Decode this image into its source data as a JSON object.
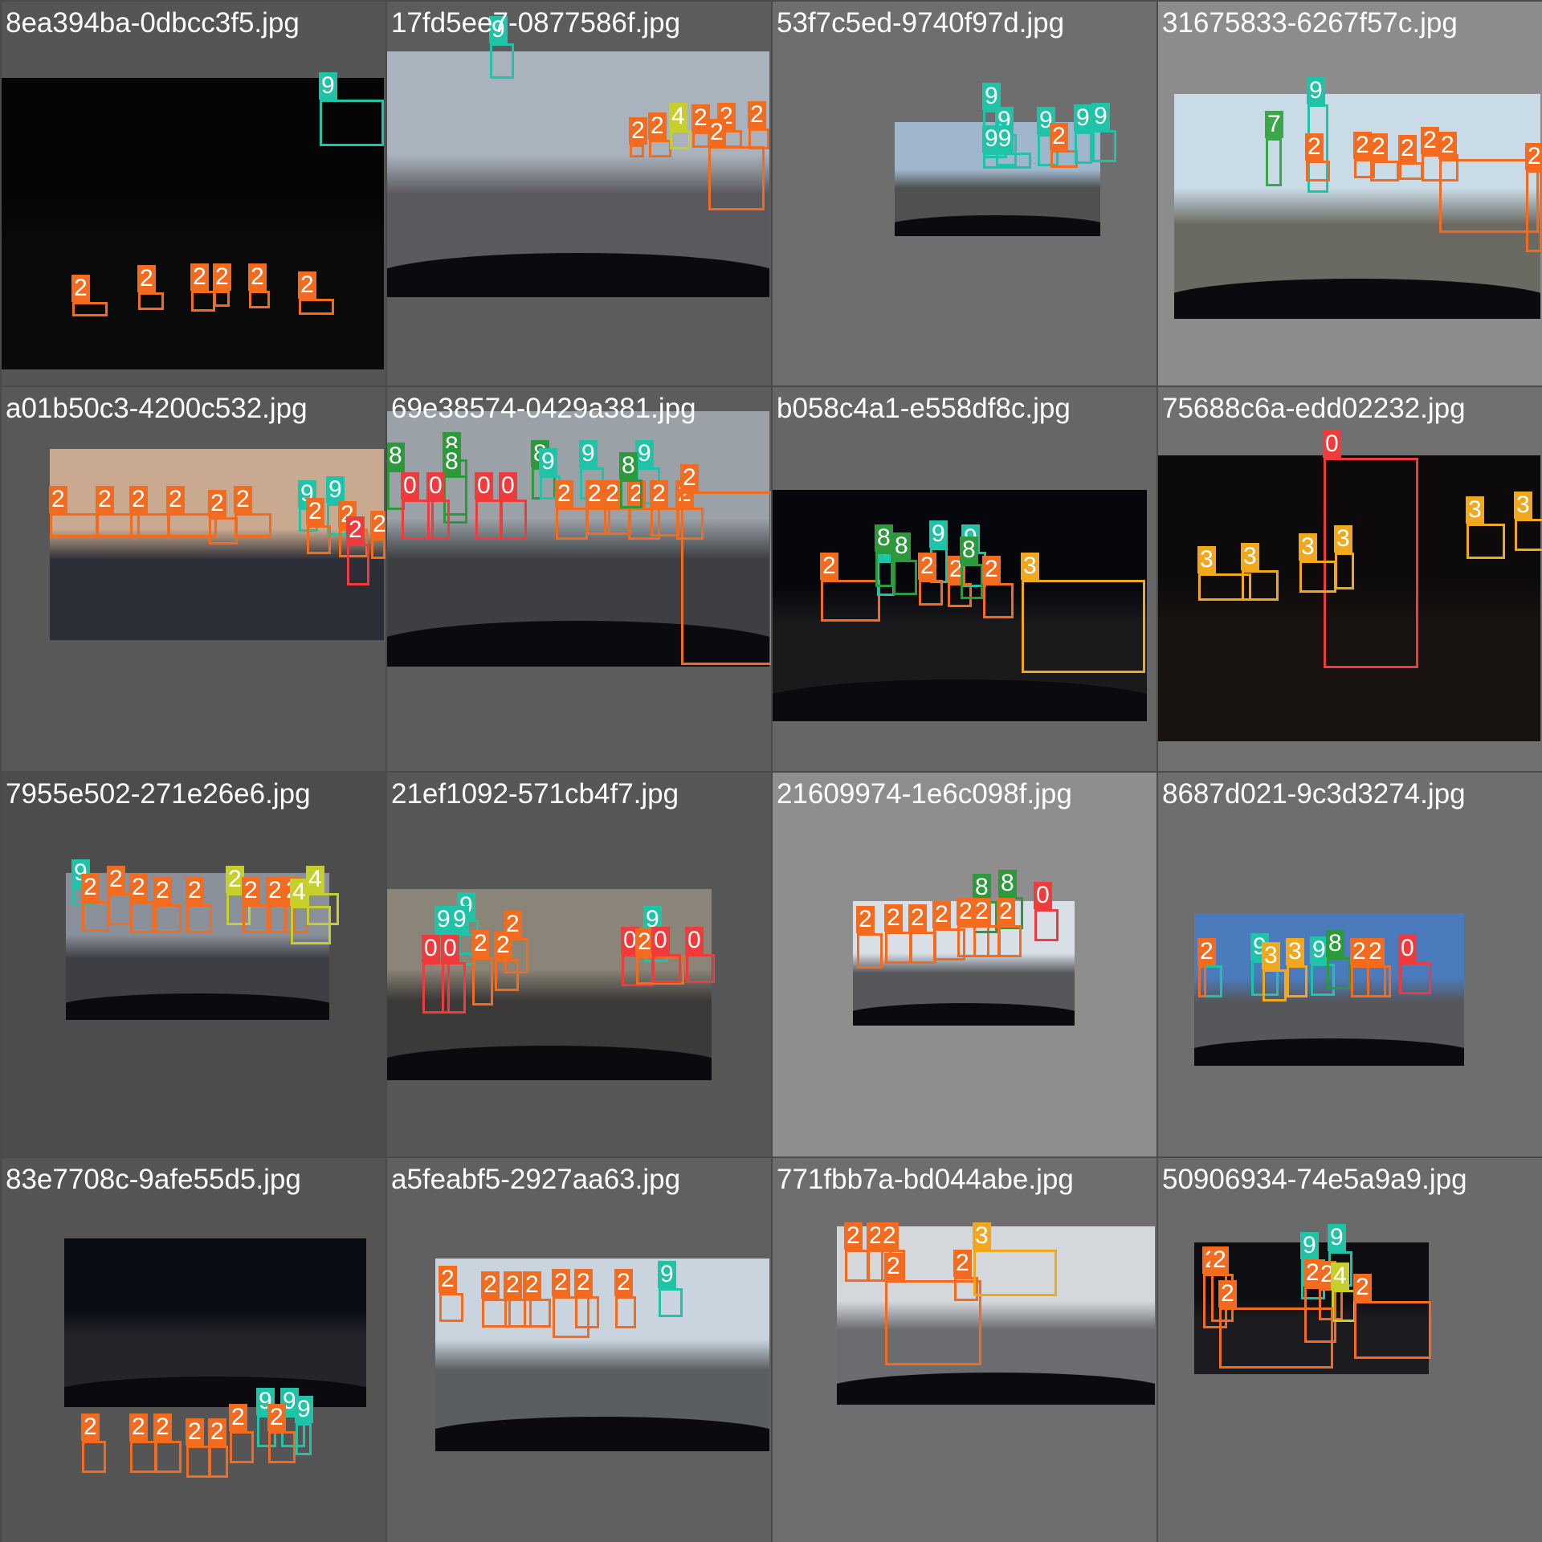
{
  "class_colors": {
    "0": "#ef3b3b",
    "2": "#f26b1f",
    "3": "#f2a81d",
    "4": "#c6cf2b",
    "7": "#3ca64a",
    "8": "#2c9a3a",
    "9": "#1fc4a8"
  },
  "tiles": [
    {
      "title": "8ea394ba-0dbcc3f5.jpg",
      "bg": "#555555",
      "photo": {
        "sky": "#050505",
        "ground": "#0a0a0a",
        "hood": false
      },
      "detections": [
        {
          "cls": "9",
          "label": "9"
        },
        {
          "cls": "2",
          "label": "2"
        },
        {
          "cls": "2",
          "label": "2"
        },
        {
          "cls": "2",
          "label": "2"
        },
        {
          "cls": "2",
          "label": "2"
        },
        {
          "cls": "2",
          "label": "2"
        },
        {
          "cls": "2",
          "label": "2"
        }
      ]
    },
    {
      "title": "17fd5ee7-0877586f.jpg",
      "bg": "#5c5c5c",
      "photo": {
        "sky": "#a9b3bd",
        "ground": "#5a5a5e",
        "hood": true
      },
      "detections": [
        {
          "cls": "9",
          "label": "9"
        },
        {
          "cls": "2",
          "label": "2"
        },
        {
          "cls": "2",
          "label": "2"
        },
        {
          "cls": "4",
          "label": "4"
        },
        {
          "cls": "2",
          "label": "2"
        },
        {
          "cls": "2",
          "label": "2"
        },
        {
          "cls": "2",
          "label": "2"
        },
        {
          "cls": "2",
          "label": "2"
        }
      ]
    },
    {
      "title": "53f7c5ed-9740f97d.jpg",
      "bg": "#6e6e6e",
      "photo": {
        "sky": "#9fb6cc",
        "ground": "#4e5150",
        "hood": true
      },
      "detections": [
        {
          "cls": "9",
          "label": "9"
        },
        {
          "cls": "9",
          "label": "9"
        },
        {
          "cls": "9",
          "label": "99"
        },
        {
          "cls": "9",
          "label": "9"
        },
        {
          "cls": "2",
          "label": "2"
        },
        {
          "cls": "9",
          "label": "9"
        },
        {
          "cls": "9",
          "label": "9"
        }
      ]
    },
    {
      "title": "31675833-6267f57c.jpg",
      "bg": "#8c8c8c",
      "photo": {
        "sky": "#c8dbe6",
        "ground": "#6b6a62",
        "hood": true
      },
      "detections": [
        {
          "cls": "9",
          "label": "9"
        },
        {
          "cls": "7",
          "label": "7"
        },
        {
          "cls": "2",
          "label": "2"
        },
        {
          "cls": "2",
          "label": "2"
        },
        {
          "cls": "2",
          "label": "2"
        },
        {
          "cls": "2",
          "label": "2"
        },
        {
          "cls": "2",
          "label": "2"
        },
        {
          "cls": "2",
          "label": "2"
        },
        {
          "cls": "2",
          "label": "2"
        }
      ]
    },
    {
      "title": "a01b50c3-4200c532.jpg",
      "bg": "#585858",
      "photo": {
        "sky": "#c9a98f",
        "ground": "#2b2e36",
        "hood": false
      },
      "detections": [
        {
          "cls": "2",
          "label": "2"
        },
        {
          "cls": "2",
          "label": "2"
        },
        {
          "cls": "2",
          "label": "2"
        },
        {
          "cls": "2",
          "label": "2"
        },
        {
          "cls": "2",
          "label": "2"
        },
        {
          "cls": "2",
          "label": "2"
        },
        {
          "cls": "9",
          "label": "9"
        },
        {
          "cls": "9",
          "label": "9"
        },
        {
          "cls": "2",
          "label": "2"
        },
        {
          "cls": "2",
          "label": "2"
        },
        {
          "cls": "0",
          "label": "2"
        },
        {
          "cls": "2",
          "label": "2"
        }
      ]
    },
    {
      "title": "69e38574-0429a381.jpg",
      "bg": "#5c5c5c",
      "photo": {
        "sky": "#9aa2a8",
        "ground": "#3d3f42",
        "hood": true
      },
      "detections": [
        {
          "cls": "8",
          "label": "8"
        },
        {
          "cls": "8",
          "label": "8"
        },
        {
          "cls": "8",
          "label": "8"
        },
        {
          "cls": "8",
          "label": "8"
        },
        {
          "cls": "9",
          "label": "9"
        },
        {
          "cls": "9",
          "label": "9"
        },
        {
          "cls": "9",
          "label": "9"
        },
        {
          "cls": "0",
          "label": "0"
        },
        {
          "cls": "0",
          "label": "0"
        },
        {
          "cls": "0",
          "label": "0"
        },
        {
          "cls": "0",
          "label": "0"
        },
        {
          "cls": "2",
          "label": "2"
        },
        {
          "cls": "2",
          "label": "2"
        },
        {
          "cls": "2",
          "label": "2"
        },
        {
          "cls": "2",
          "label": "2"
        },
        {
          "cls": "2",
          "label": "2"
        },
        {
          "cls": "2",
          "label": "2"
        },
        {
          "cls": "8",
          "label": "8"
        },
        {
          "cls": "2",
          "label": "2"
        }
      ]
    },
    {
      "title": "b058c4a1-e558df8c.jpg",
      "bg": "#666666",
      "photo": {
        "sky": "#06070c",
        "ground": "#1a1a1c",
        "hood": true
      },
      "detections": [
        {
          "cls": "2",
          "label": "2"
        },
        {
          "cls": "9",
          "label": "9"
        },
        {
          "cls": "8",
          "label": "8"
        },
        {
          "cls": "8",
          "label": "8"
        },
        {
          "cls": "9",
          "label": "9"
        },
        {
          "cls": "9",
          "label": "9"
        },
        {
          "cls": "2",
          "label": "2"
        },
        {
          "cls": "2",
          "label": "2"
        },
        {
          "cls": "8",
          "label": "8"
        },
        {
          "cls": "2",
          "label": "2"
        },
        {
          "cls": "3",
          "label": "3"
        }
      ]
    },
    {
      "title": "75688c6a-edd02232.jpg",
      "bg": "#707070",
      "photo": {
        "sky": "#0c0a0a",
        "ground": "#181210",
        "hood": false
      },
      "detections": [
        {
          "cls": "0",
          "label": "0"
        },
        {
          "cls": "3",
          "label": "3"
        },
        {
          "cls": "3",
          "label": "3"
        },
        {
          "cls": "3",
          "label": "3"
        },
        {
          "cls": "3",
          "label": "3"
        },
        {
          "cls": "3",
          "label": "3"
        },
        {
          "cls": "3",
          "label": "3"
        },
        {
          "cls": "3",
          "label": "3"
        },
        {
          "cls": "3",
          "label": "3"
        }
      ]
    },
    {
      "title": "7955e502-271e26e6.jpg",
      "bg": "#4c4c4c",
      "photo": {
        "sky": "#8a9099",
        "ground": "#3d3f44",
        "hood": true
      },
      "detections": [
        {
          "cls": "9",
          "label": "9"
        },
        {
          "cls": "2",
          "label": "2"
        },
        {
          "cls": "2",
          "label": "2"
        },
        {
          "cls": "2",
          "label": "2"
        },
        {
          "cls": "2",
          "label": "2"
        },
        {
          "cls": "2",
          "label": "2"
        },
        {
          "cls": "4",
          "label": "2"
        },
        {
          "cls": "2",
          "label": "2"
        },
        {
          "cls": "2",
          "label": "2"
        },
        {
          "cls": "2",
          "label": "2"
        },
        {
          "cls": "4",
          "label": "4"
        },
        {
          "cls": "4",
          "label": "4"
        }
      ]
    },
    {
      "title": "21ef1092-571cb4f7.jpg",
      "bg": "#575757",
      "photo": {
        "sky": "#8b8478",
        "ground": "#3b3a38",
        "hood": true
      },
      "detections": [
        {
          "cls": "9",
          "label": "9"
        },
        {
          "cls": "9",
          "label": "9"
        },
        {
          "cls": "9",
          "label": "9"
        },
        {
          "cls": "2",
          "label": "2"
        },
        {
          "cls": "0",
          "label": "0"
        },
        {
          "cls": "0",
          "label": "0"
        },
        {
          "cls": "2",
          "label": "2"
        },
        {
          "cls": "2",
          "label": "2"
        },
        {
          "cls": "9",
          "label": "9"
        },
        {
          "cls": "0",
          "label": "0"
        },
        {
          "cls": "2",
          "label": "2"
        },
        {
          "cls": "0",
          "label": "0"
        },
        {
          "cls": "0",
          "label": "0"
        }
      ]
    },
    {
      "title": "21609974-1e6c098f.jpg",
      "bg": "#8e8e8e",
      "photo": {
        "sky": "#d8dfe6",
        "ground": "#55575b",
        "hood": true
      },
      "detections": [
        {
          "cls": "2",
          "label": "2"
        },
        {
          "cls": "2",
          "label": "2"
        },
        {
          "cls": "2",
          "label": "2"
        },
        {
          "cls": "2",
          "label": "2"
        },
        {
          "cls": "2",
          "label": "2"
        },
        {
          "cls": "8",
          "label": "8"
        },
        {
          "cls": "8",
          "label": "8"
        },
        {
          "cls": "2",
          "label": "2"
        },
        {
          "cls": "2",
          "label": "2"
        },
        {
          "cls": "0",
          "label": "0"
        }
      ]
    },
    {
      "title": "8687d021-9c3d3274.jpg",
      "bg": "#6e6e6e",
      "photo": {
        "sky": "#4b7bbd",
        "ground": "#55575a",
        "hood": true
      },
      "detections": [
        {
          "cls": "9",
          "label": "9"
        },
        {
          "cls": "2",
          "label": "2"
        },
        {
          "cls": "9",
          "label": "9"
        },
        {
          "cls": "3",
          "label": "3"
        },
        {
          "cls": "3",
          "label": "3"
        },
        {
          "cls": "9",
          "label": "9"
        },
        {
          "cls": "8",
          "label": "8"
        },
        {
          "cls": "2",
          "label": "2"
        },
        {
          "cls": "2",
          "label": "2"
        },
        {
          "cls": "0",
          "label": "0"
        }
      ]
    },
    {
      "title": "83e7708c-9afe55d5.jpg",
      "bg": "#555555",
      "photo": {
        "sky": "#0a0c14",
        "ground": "#24252a",
        "hood": true
      },
      "detections": [
        {
          "cls": "2",
          "label": "2"
        },
        {
          "cls": "2",
          "label": "2"
        },
        {
          "cls": "2",
          "label": "2"
        },
        {
          "cls": "2",
          "label": "2"
        },
        {
          "cls": "2",
          "label": "2"
        },
        {
          "cls": "2",
          "label": "2"
        },
        {
          "cls": "9",
          "label": "9"
        },
        {
          "cls": "9",
          "label": "9"
        },
        {
          "cls": "2",
          "label": "2"
        },
        {
          "cls": "9",
          "label": "9"
        }
      ]
    },
    {
      "title": "a5feabf5-2927aa63.jpg",
      "bg": "#606060",
      "photo": {
        "sky": "#c9d4de",
        "ground": "#5b5e60",
        "hood": true
      },
      "detections": [
        {
          "cls": "2",
          "label": "2"
        },
        {
          "cls": "2",
          "label": "2"
        },
        {
          "cls": "2",
          "label": "2"
        },
        {
          "cls": "2",
          "label": "2"
        },
        {
          "cls": "2",
          "label": "2"
        },
        {
          "cls": "2",
          "label": "2"
        },
        {
          "cls": "2",
          "label": "2"
        },
        {
          "cls": "9",
          "label": "9"
        }
      ]
    },
    {
      "title": "771fbb7a-bd044abe.jpg",
      "bg": "#6e6e6e",
      "photo": {
        "sky": "#d4d8dc",
        "ground": "#6a6c70",
        "hood": true
      },
      "detections": [
        {
          "cls": "2",
          "label": "2"
        },
        {
          "cls": "2",
          "label": "2"
        },
        {
          "cls": "2",
          "label": "2"
        },
        {
          "cls": "2",
          "label": "2"
        },
        {
          "cls": "2",
          "label": "2"
        },
        {
          "cls": "3",
          "label": "3"
        }
      ]
    },
    {
      "title": "50906934-74e5a9a9.jpg",
      "bg": "#6a6a6a",
      "photo": {
        "sky": "#0d0d12",
        "ground": "#1c1c20",
        "hood": false
      },
      "detections": [
        {
          "cls": "2",
          "label": "2"
        },
        {
          "cls": "2",
          "label": "2"
        },
        {
          "cls": "9",
          "label": "9"
        },
        {
          "cls": "9",
          "label": "9"
        },
        {
          "cls": "2",
          "label": "2"
        },
        {
          "cls": "2",
          "label": "2"
        },
        {
          "cls": "4",
          "label": "4"
        },
        {
          "cls": "2",
          "label": "2"
        },
        {
          "cls": "2",
          "label": "2"
        }
      ]
    }
  ]
}
